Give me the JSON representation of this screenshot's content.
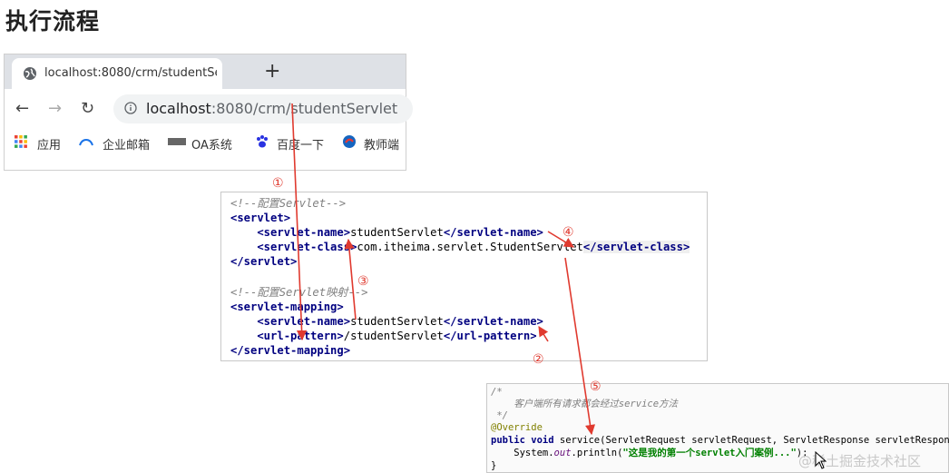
{
  "title": "执行流程",
  "browser": {
    "tab_title": "localhost:8080/crm/studentSe",
    "new_tab_symbol": "+",
    "url_host": "localhost",
    "url_rest": ":8080/crm/studentServlet",
    "bookmarks": [
      {
        "label": "应用",
        "icon": "apps-grid-icon"
      },
      {
        "label": "企业邮箱",
        "icon": "mail-cloud-icon"
      },
      {
        "label": "OA系统",
        "icon": "oa-logo-icon"
      },
      {
        "label": "百度一下",
        "icon": "baidu-paw-icon"
      },
      {
        "label": "教师端",
        "icon": "teacher-logo-icon"
      }
    ]
  },
  "xml_code": {
    "line1": "<!--配置Servlet-->",
    "line2_open": "<servlet>",
    "line3_a": "    <servlet-name>",
    "line3_b": "studentServlet",
    "line3_c": "</servlet-name>",
    "line4_a": "    <servlet-class>",
    "line4_b": "com.itheima.servlet.StudentServlet",
    "line4_c": "</servlet-class>",
    "line5": "</servlet>",
    "line7": "<!--配置Servlet映射-->",
    "line8": "<servlet-mapping>",
    "line9_a": "    <servlet-name>",
    "line9_b": "studentServlet",
    "line9_c": "</servlet-name>",
    "line10_a": "    <url-pattern>",
    "line10_b": "/studentServlet",
    "line10_c": "</url-pattern>",
    "line11": "</servlet-mapping>"
  },
  "java_code": {
    "line1": "/*",
    "line2": "    客户端所有请求都会经过service方法",
    "line3": " */",
    "line4": "@Override",
    "line5_kw": "public void",
    "line5_rest": " service(ServletRequest servletRequest, ServletResponse servletResponse) {",
    "line6_a": "    System.",
    "line6_out": "out",
    "line6_b": ".println(",
    "line6_str": "\"这是我的第一个servlet入门案例...\"",
    "line6_c": ");",
    "line7": "}"
  },
  "steps": [
    "①",
    "②",
    "③",
    "④",
    "⑤"
  ],
  "watermark": "@稀土掘金技术社区",
  "colors": {
    "arrow": "#e03a2f",
    "tab_bar": "#dee1e6",
    "url_bg": "#f1f3f4",
    "xml_tag": "#000080"
  }
}
